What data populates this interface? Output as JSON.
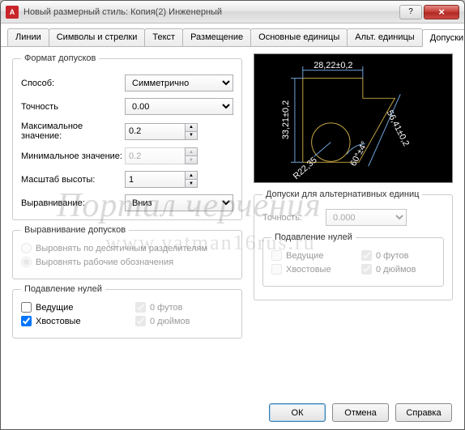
{
  "window": {
    "app_glyph": "A",
    "title": "Новый размерный стиль: Копия(2) Инженерный"
  },
  "tabs": {
    "t0": "Линии",
    "t1": "Символы и стрелки",
    "t2": "Текст",
    "t3": "Размещение",
    "t4": "Основные единицы",
    "t5": "Альт. единицы",
    "t6": "Допуски"
  },
  "format": {
    "legend": "Формат допусков",
    "method_label": "Способ:",
    "method_value": "Симметрично",
    "precision_label": "Точность",
    "precision_value": "0.00",
    "max_label": "Максимальное значение:",
    "max_value": "0.2",
    "min_label": "Минимальное значение:",
    "min_value": "0.2",
    "scale_label": "Масштаб высоты:",
    "scale_value": "1",
    "align_label": "Выравнивание:",
    "align_value": "Вниз"
  },
  "tol_align": {
    "legend": "Выравнивание допусков",
    "r1": "Выровнять по десятичным разделителям",
    "r2": "Выровнять рабочие обозначения"
  },
  "zero_left": {
    "legend": "Подавление нулей",
    "c1": "Ведущие",
    "c2": "Хвостовые",
    "c3": "0 футов",
    "c4": "0 дюймов"
  },
  "alt": {
    "legend": "Допуски для альтернативных единиц",
    "precision_label": "Точность:",
    "precision_value": "0.000"
  },
  "zero_right": {
    "legend": "Подавление нулей",
    "c1": "Ведущие",
    "c2": "Хвостовые",
    "c3": "0 футов",
    "c4": "0 дюймов"
  },
  "preview": {
    "dim_top": "28,22±0,2",
    "dim_left": "33,21±0,2",
    "dim_diag": "56,41±0,2",
    "dim_rad": "R22,35",
    "dim_ang": "60°±4°"
  },
  "footer": {
    "ok": "ОК",
    "cancel": "Отмена",
    "help": "Справка"
  },
  "watermark": {
    "l1": "Портал черчения",
    "l2": "www.vatman16rus.ru"
  }
}
